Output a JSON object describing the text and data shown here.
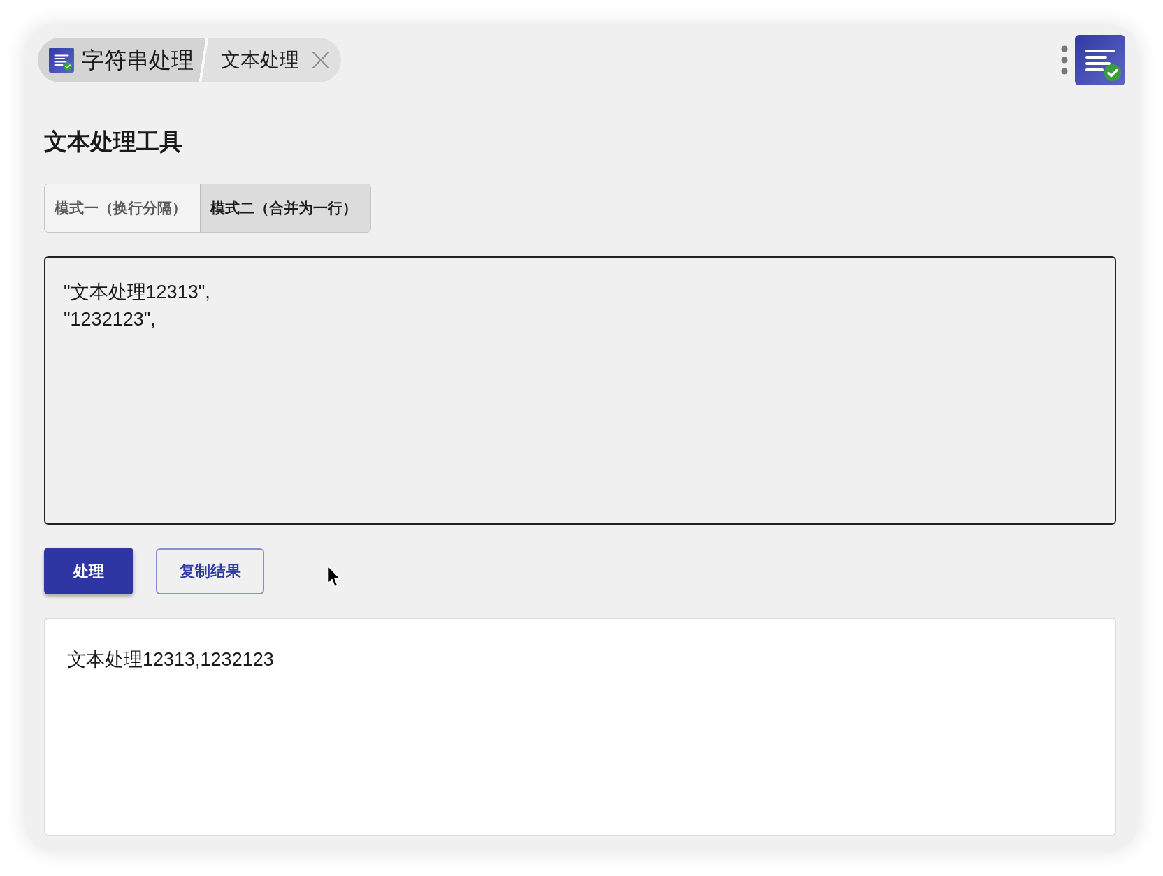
{
  "breadcrumb": {
    "app_title": "字符串处理",
    "page_title": "文本处理"
  },
  "heading": "文本处理工具",
  "mode_tabs": [
    {
      "label": "模式一（换行分隔）",
      "selected": false
    },
    {
      "label": "模式二（合并为一行）",
      "selected": true
    }
  ],
  "input": {
    "value": "\"文本处理12313\",\n\"1232123\","
  },
  "buttons": [
    {
      "label": "处理",
      "kind": "primary"
    },
    {
      "label": "复制结果",
      "kind": "outline"
    }
  ],
  "output": {
    "value": "文本处理12313,1232123"
  }
}
